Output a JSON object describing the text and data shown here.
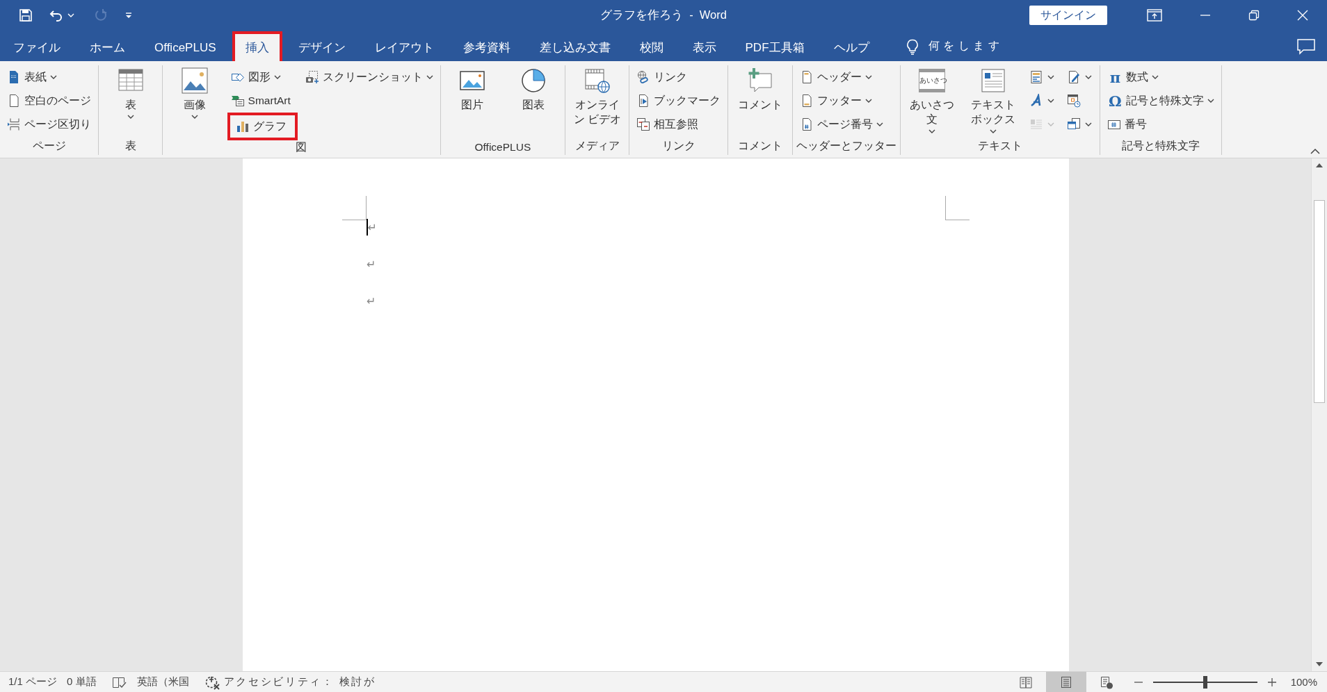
{
  "window": {
    "title": "グラフを作ろう  -  Word",
    "sign_in": "サインイン"
  },
  "tabs": [
    {
      "label": "ファイル",
      "selected": false,
      "highlighted": false
    },
    {
      "label": "ホーム",
      "selected": false,
      "highlighted": false
    },
    {
      "label": "OfficePLUS",
      "selected": false,
      "highlighted": false
    },
    {
      "label": "挿入",
      "selected": true,
      "highlighted": true
    },
    {
      "label": "デザイン",
      "selected": false,
      "highlighted": false
    },
    {
      "label": "レイアウト",
      "selected": false,
      "highlighted": false
    },
    {
      "label": "参考資料",
      "selected": false,
      "highlighted": false
    },
    {
      "label": "差し込み文書",
      "selected": false,
      "highlighted": false
    },
    {
      "label": "校閲",
      "selected": false,
      "highlighted": false
    },
    {
      "label": "表示",
      "selected": false,
      "highlighted": false
    },
    {
      "label": "PDF工具箱",
      "selected": false,
      "highlighted": false
    },
    {
      "label": "ヘルプ",
      "selected": false,
      "highlighted": false
    }
  ],
  "tell_me": "何をします",
  "ribbon_groups": [
    {
      "label": "ページ",
      "columns": [
        [
          {
            "kind": "small",
            "label": "表紙",
            "dropdown": true,
            "highlighted": false
          },
          {
            "kind": "small",
            "label": "空白のページ",
            "dropdown": false,
            "highlighted": false
          },
          {
            "kind": "small",
            "label": "ページ区切り",
            "dropdown": false,
            "highlighted": false
          }
        ]
      ]
    },
    {
      "label": "表",
      "columns": [
        [
          {
            "kind": "large",
            "label": "表",
            "dropdown": true,
            "highlighted": false
          }
        ]
      ]
    },
    {
      "label": "図",
      "columns": [
        [
          {
            "kind": "large",
            "label": "画像",
            "dropdown": true,
            "highlighted": false
          }
        ],
        [
          {
            "kind": "small",
            "label": "図形",
            "dropdown": true,
            "highlighted": false
          },
          {
            "kind": "small",
            "label": "SmartArt",
            "dropdown": false,
            "highlighted": false
          },
          {
            "kind": "small",
            "label": "グラフ",
            "dropdown": false,
            "highlighted": true
          }
        ],
        [
          {
            "kind": "small",
            "label": "スクリーンショット",
            "dropdown": true,
            "highlighted": false
          }
        ]
      ]
    },
    {
      "label": "OfficePLUS",
      "columns": [
        [
          {
            "kind": "large",
            "label": "图片",
            "dropdown": false,
            "highlighted": false
          }
        ],
        [
          {
            "kind": "large",
            "label": "图表",
            "dropdown": false,
            "highlighted": false
          }
        ]
      ]
    },
    {
      "label": "メディア",
      "columns": [
        [
          {
            "kind": "large",
            "label": "オンライン ビデオ",
            "dropdown": false,
            "highlighted": false
          }
        ]
      ]
    },
    {
      "label": "リンク",
      "columns": [
        [
          {
            "kind": "small",
            "label": "リンク",
            "dropdown": false,
            "highlighted": false
          },
          {
            "kind": "small",
            "label": "ブックマーク",
            "dropdown": false,
            "highlighted": false
          },
          {
            "kind": "small",
            "label": "相互参照",
            "dropdown": false,
            "highlighted": false
          }
        ]
      ]
    },
    {
      "label": "コメント",
      "columns": [
        [
          {
            "kind": "large",
            "label": "コメント",
            "dropdown": false,
            "highlighted": false
          }
        ]
      ]
    },
    {
      "label": "ヘッダーとフッター",
      "columns": [
        [
          {
            "kind": "small",
            "label": "ヘッダー",
            "dropdown": true,
            "highlighted": false
          },
          {
            "kind": "small",
            "label": "フッター",
            "dropdown": true,
            "highlighted": false
          },
          {
            "kind": "small",
            "label": "ページ番号",
            "dropdown": true,
            "highlighted": false
          }
        ]
      ]
    },
    {
      "label": "テキスト",
      "columns": [
        [
          {
            "kind": "large",
            "label": "あいさつ文",
            "icon_text": "あいさつ",
            "dropdown": true,
            "highlighted": false
          }
        ],
        [
          {
            "kind": "large",
            "label": "テキストボックス",
            "dropdown": true,
            "highlighted": false
          }
        ],
        [
          {
            "kind": "icon",
            "dropdown": true,
            "disabled": false,
            "highlighted": false
          },
          {
            "kind": "icon",
            "dropdown": true,
            "disabled": false,
            "highlighted": false
          },
          {
            "kind": "icon",
            "dropdown": true,
            "disabled": true,
            "highlighted": false
          }
        ],
        [
          {
            "kind": "icon",
            "dropdown": true,
            "disabled": false,
            "highlighted": false
          },
          {
            "kind": "icon",
            "dropdown": false,
            "disabled": false,
            "highlighted": false
          },
          {
            "kind": "icon",
            "dropdown": true,
            "disabled": false,
            "highlighted": false
          }
        ]
      ]
    },
    {
      "label": "記号と特殊文字",
      "columns": [
        [
          {
            "kind": "small",
            "label": "数式",
            "symbol": "π",
            "dropdown": true,
            "highlighted": false
          },
          {
            "kind": "small",
            "label": "記号と特殊文字",
            "symbol": "Ω",
            "dropdown": true,
            "highlighted": false
          },
          {
            "kind": "small",
            "label": "番号",
            "dropdown": false,
            "highlighted": false
          }
        ]
      ]
    }
  ],
  "document": {
    "paragraph_marks": [
      "↵",
      "↵",
      "↵"
    ]
  },
  "status_bar": {
    "page": "1/1 ページ",
    "words": "0 単語",
    "language": "英語（米国",
    "accessibility": "アクセシビリティ： 検討が",
    "views": [
      {
        "selected": false
      },
      {
        "selected": true
      },
      {
        "selected": false
      }
    ],
    "zoom": {
      "level": 0.5,
      "reading": "100%"
    }
  }
}
